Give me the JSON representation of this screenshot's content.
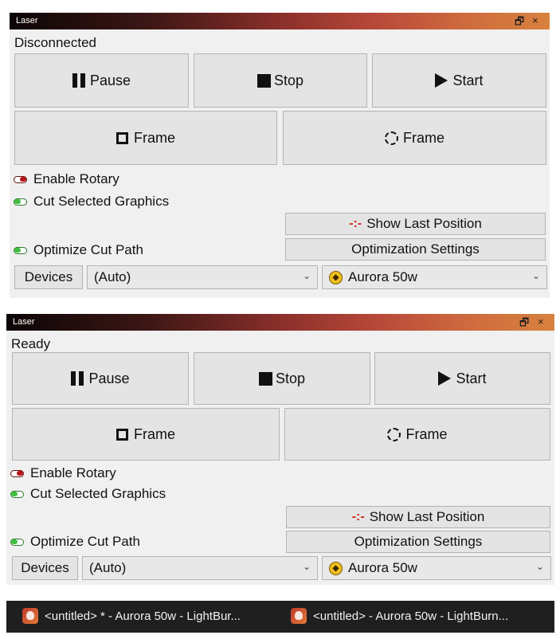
{
  "panels": [
    {
      "title": "Laser",
      "status": "Disconnected",
      "buttons": {
        "pause": "Pause",
        "stop": "Stop",
        "start": "Start",
        "frame_rect": "Frame",
        "frame_circle": "Frame"
      },
      "toggles": {
        "enable_rotary": "Enable Rotary",
        "enable_rotary_state": "off",
        "cut_selected": "Cut Selected Graphics",
        "cut_selected_state": "on",
        "optimize_cut_path": "Optimize Cut Path",
        "optimize_cut_path_state": "on"
      },
      "show_last_position": "Show Last Position",
      "optimization_settings": "Optimization Settings",
      "devices": "Devices",
      "port": "(Auto)",
      "device_name": "Aurora 50w"
    },
    {
      "title": "Laser",
      "status": "Ready",
      "buttons": {
        "pause": "Pause",
        "stop": "Stop",
        "start": "Start",
        "frame_rect": "Frame",
        "frame_circle": "Frame"
      },
      "toggles": {
        "enable_rotary": "Enable Rotary",
        "enable_rotary_state": "off",
        "cut_selected": "Cut Selected Graphics",
        "cut_selected_state": "on",
        "optimize_cut_path": "Optimize Cut Path",
        "optimize_cut_path_state": "on"
      },
      "show_last_position": "Show Last Position",
      "optimization_settings": "Optimization Settings",
      "devices": "Devices",
      "port": "(Auto)",
      "device_name": "Aurora 50w"
    }
  ],
  "window_controls": {
    "restore": "🗗",
    "close": "×"
  },
  "taskbar": {
    "items": [
      {
        "label": "<untitled> * - Aurora 50w - LightBur..."
      },
      {
        "label": "<untitled> - Aurora 50w - LightBurn..."
      }
    ]
  },
  "colors": {
    "accent": "#d8823f",
    "toggle_on": "#3fbf3f",
    "toggle_off": "#b8151a"
  }
}
